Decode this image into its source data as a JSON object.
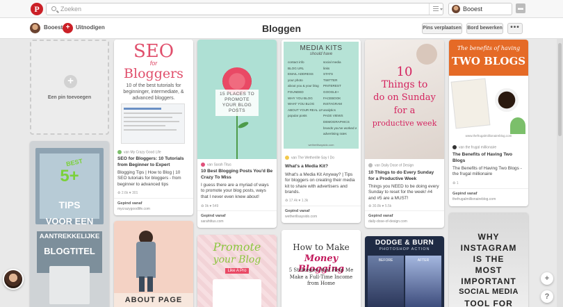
{
  "topbar": {
    "logo": "P",
    "search_placeholder": "Zoeken",
    "user_name": "Booest",
    "message_icon": "speech-bubble-icon"
  },
  "board": {
    "owner": "Booest",
    "invite_label": "Uitnodigen",
    "title": "Bloggen",
    "move_pins_label": "Pins verplaatsen",
    "edit_board_label": "Bord bewerken",
    "more_label": "•••"
  },
  "add_pin": {
    "plus": "+",
    "label": "Een pin toevoegen"
  },
  "pins": [
    {
      "image_title": "SEO",
      "image_sub": "for",
      "image_big": "Bloggers",
      "image_caption": "10 of the best tutorials for beginninger, intermediate, & advanced bloggers.",
      "via": "van My Crazy Good Life",
      "title": "SEO for Bloggers: 10 Tutorials from Beginner to Expert",
      "desc": "Blogging Tips | How to Blog | 10 SEO tutorials for bloggers - from beginner to advanced tips",
      "stats": "♻ 2.6k   ♥ 301",
      "saved": "Gepind vanaf",
      "domain": "mycrazygoodlife.com"
    },
    {
      "image_caption": "15 PLACES TO PROMOTE YOUR BLOG POSTS",
      "via": "van Sarah Titus",
      "title": "10 Best Blogging Posts You'd Be Crazy To Miss",
      "desc": "I guess there are a myriad of ways to promote your blog posts, ways that I never even knew about!",
      "stats": "♻ 9k   ♥ 549",
      "saved": "Gepind vanaf",
      "domain": "sarahtitus.com"
    },
    {
      "image_title": "MEDIA KITS",
      "image_sub": "should have",
      "left_list": [
        "contact info",
        "BLOG URL",
        "EMAIL ADDRESS",
        "your photo",
        "about you & your blog",
        "FOUNDED",
        "WHY YOU BLOG",
        "WHAT YOU BLOG",
        "ABOUT YOUR REAL LIFE",
        "popular posts"
      ],
      "right_list": [
        "social media",
        "links",
        "STATS",
        "TWITTER",
        "PINTEREST",
        "GOOGLE+",
        "FACEBOOK",
        "INSTAGRAM",
        "analytics",
        "PAGE VIEWS",
        "DEMOGRAPHICS",
        "brands you've worked with",
        "advertising rates"
      ],
      "image_footer": "wetherillsaysido.com",
      "via": "van The Wetherille Say I Do",
      "title": "What's a Media Kit?",
      "desc": "What's a Media Kit Anyway? | Tips for bloggers on creating their media kit to share with advertisers and brands.",
      "stats": "♻ 17.4k   ♥ 1.3k",
      "saved": "Gepind vanaf",
      "domain": "wetherillsaysido.com"
    },
    {
      "image_num": "10",
      "image_line1": "Things to",
      "image_line2": "do on Sunday",
      "image_line3": "for a",
      "image_line4": "productive week",
      "via": "van Daily Dose of Design",
      "title": "10 Things to do Every Sunday for a Productive Week",
      "desc": "Things you NEED to be doing every Sunday to reset for the week! #4 and #5 are a MUST!",
      "stats": "♻ 30.8k   ♥ 5.5k",
      "saved": "Gepind vanaf",
      "domain": "daily-dose-of-design.com"
    },
    {
      "image_line1": "The benefits of having",
      "image_line2": "TWO BLOGS",
      "image_footer": "www.thefrugalmillionaireblog.com",
      "via": "van the frugal millionaire",
      "title": "The Benefits of Having Two Blogs",
      "desc": "The Benefits of Having Two Blogs - the frugal millionaire",
      "stats": "♻ 1",
      "saved": "Gepind vanaf",
      "domain": "thefrugalmillionaireblog.com"
    }
  ],
  "row2": {
    "blogtitle_lines": [
      "5+",
      "TIPS",
      "VOOR EEN",
      "AANTREKKELIJKE",
      "BLOGTITEL"
    ],
    "blogtitle_best": "BEST",
    "about_page": "ABOUT PAGE",
    "promote_line1": "Promote",
    "promote_line2": "your Blog",
    "promote_line3": "Like A Pro",
    "money_line1": "How to Make",
    "money_line2": "Money Blogging",
    "money_line3": "5 Strategies that Help Me Make a Full-Time Income from Home",
    "dodge_title": "DODGE & BURN",
    "dodge_sub": "PHOTOSHOP ACTION",
    "before": "BEFORE",
    "after": "AFTER",
    "instagram_lines": [
      "WHY",
      "INSTAGRAM",
      "IS THE",
      "MOST",
      "IMPORTANT",
      "SOCIAL MEDIA",
      "TOOL FOR"
    ]
  },
  "fabs": {
    "plus": "+",
    "help": "?"
  },
  "colors": {
    "pinterest_red": "#cb2027",
    "background": "#e9e9e9",
    "orange": "#e56a26"
  }
}
